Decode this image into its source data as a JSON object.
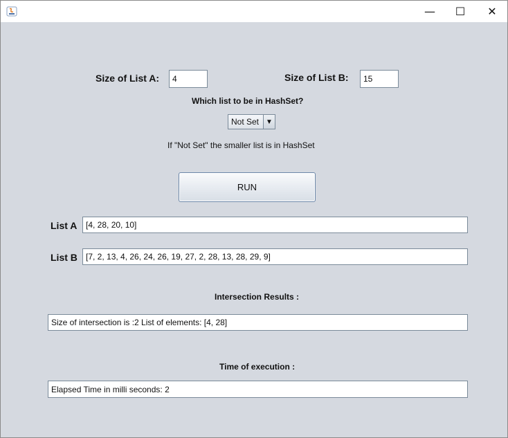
{
  "window": {
    "icon": "java-icon",
    "controls": {
      "minimize": "—",
      "maximize": "☐",
      "close": "✕"
    }
  },
  "form": {
    "size_a_label": "Size of List A:",
    "size_a_value": "4",
    "size_b_label": "Size of List B:",
    "size_b_value": "15",
    "hashset_question": "Which list to be in HashSet?",
    "hashset_selected": "Not Set",
    "hashset_note": "If \"Not Set\" the smaller list is in HashSet",
    "run_label": "RUN"
  },
  "lists": {
    "list_a_label": "List A",
    "list_a_value": "[4, 28, 20, 10]",
    "list_b_label": "List B",
    "list_b_value": "[7, 2, 13, 4, 26, 24, 26, 19, 27, 2, 28, 13, 28, 29, 9]"
  },
  "results": {
    "intersection_heading": "Intersection Results :",
    "intersection_value": "Size of intersection is :2  List of elements: [4, 28]",
    "time_heading": "Time of execution  :",
    "time_value": "Elapsed Time in milli seconds: 2"
  }
}
